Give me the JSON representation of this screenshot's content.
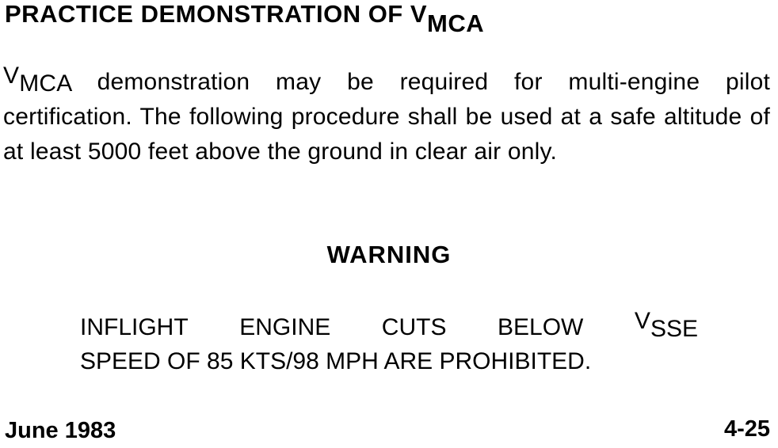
{
  "heading": {
    "prefix": "PRACTICE DEMONSTRATION OF V",
    "subscript": "MCA"
  },
  "paragraph": {
    "v_symbol": "V",
    "v_subscript": "MCA",
    "text": " demonstration may be required for multi-engine pilot certification. The following procedure shall be used at a safe altitude of at least 5000 feet above the ground in clear air only."
  },
  "warning": {
    "title": "WARNING",
    "line1_words": [
      "INFLIGHT",
      "ENGINE",
      "CUTS",
      "BELOW"
    ],
    "v_symbol": "V",
    "v_subscript": "SSE",
    "line2": "SPEED OF 85 KTS/98 MPH ARE PROHIBITED."
  },
  "footer": {
    "date": "June 1983",
    "page_number": "4-25"
  }
}
